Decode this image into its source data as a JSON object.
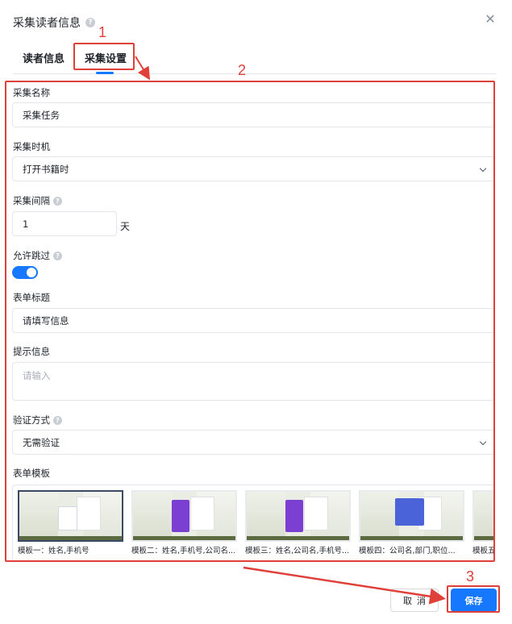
{
  "dialog": {
    "title": "采集读者信息",
    "help_icon": "question-circle-icon",
    "close_icon": "close-icon",
    "close_glyph": "✕"
  },
  "tabs": [
    {
      "label": "读者信息",
      "active": false
    },
    {
      "label": "采集设置",
      "active": true
    }
  ],
  "form": {
    "collect_name": {
      "label": "采集名称",
      "value": "采集任务"
    },
    "collect_timing": {
      "label": "采集时机",
      "value": "打开书籍时"
    },
    "collect_interval": {
      "label": "采集间隔",
      "value": "1",
      "unit": "天"
    },
    "allow_skip": {
      "label": "允许跳过",
      "enabled": true
    },
    "form_title": {
      "label": "表单标题",
      "value": "请填写信息"
    },
    "hint": {
      "label": "提示信息",
      "placeholder": "请输入"
    },
    "verify_method": {
      "label": "验证方式",
      "value": "无需验证"
    },
    "templates": {
      "label": "表单模板",
      "items": [
        {
          "caption": "模板一：姓名,手机号",
          "selected": true,
          "panel": "white"
        },
        {
          "caption": "模板二：姓名,手机号,公司名...",
          "selected": false,
          "panel": "purple"
        },
        {
          "caption": "模板三：姓名,公司名,手机号...",
          "selected": false,
          "panel": "purple"
        },
        {
          "caption": "模板四：公司名,部门,职位...",
          "selected": false,
          "panel": "blue"
        },
        {
          "caption": "模板五",
          "selected": false,
          "panel": "white"
        }
      ]
    }
  },
  "footer": {
    "cancel_label": "取消",
    "save_label": "保存"
  },
  "annotations": {
    "step1": "1",
    "step2": "2",
    "step3": "3",
    "color": "#e0403a"
  },
  "colors": {
    "primary": "#1677ff",
    "annotation": "#e0403a"
  }
}
